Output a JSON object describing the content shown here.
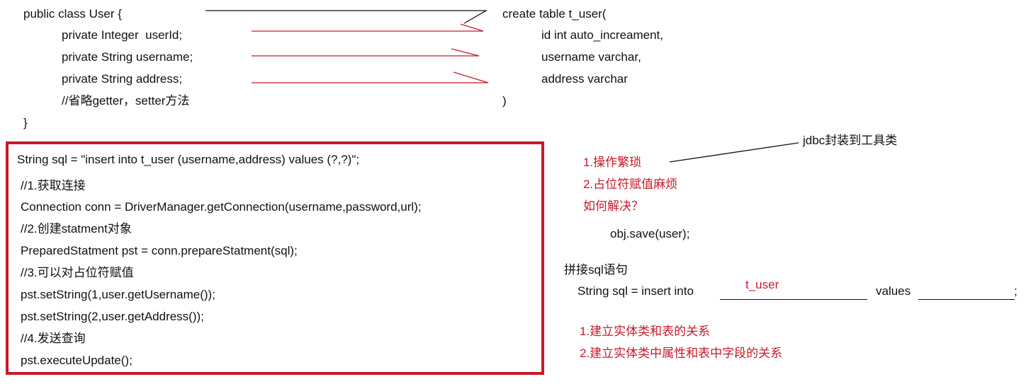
{
  "java_class": {
    "declaration": "public class User {",
    "fields": [
      "private Integer  userId;",
      "private String username;",
      "private String address;"
    ],
    "comment": "//省略getter，setter方法",
    "close": "}"
  },
  "sql_table": {
    "create": "create table t_user(",
    "columns": [
      "id int auto_increament,",
      "username varchar,",
      "address varchar"
    ],
    "close": ")"
  },
  "jdbc_code": {
    "lines": [
      "String sql = \"insert into t_user (username,address) values (?,?)\";",
      "//1.获取连接",
      "Connection conn = DriverManager.getConnection(username,password,url);",
      "//2.创建statment对象",
      "PreparedStatment pst = conn.prepareStatment(sql);",
      "//3.可以对占位符赋值",
      "pst.setString(1,user.getUsername());",
      "pst.setString(2,user.getAddress());",
      "//4.发送查询",
      "pst.executeUpdate();"
    ],
    "border_color": "#c8192a"
  },
  "notes": {
    "tool_class": "jdbc封装到工具类",
    "problems": [
      "1.操作繁琐",
      "2.占位符赋值麻烦",
      "如何解决？"
    ],
    "save_call": "obj.save(user);",
    "concat_title": "拼接sql语句",
    "concat_sql": {
      "prefix": "String sql = insert into",
      "table_fill": "t_user",
      "values_label": "values",
      "end": ";"
    },
    "relations": [
      "1.建立实体类和表的关系",
      "2.建立实体类中属性和表中字段的关系"
    ],
    "accent_color": "#c8192a"
  }
}
